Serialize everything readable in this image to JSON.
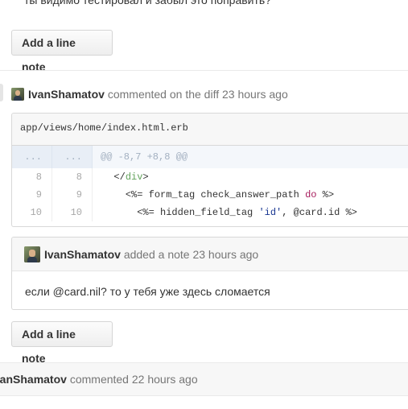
{
  "prev_comment": {
    "text": "ты видимо тестировал и забыл это поправить?"
  },
  "add_line_note_label": "Add a line note",
  "comment1": {
    "author": "IvanShamatov",
    "action": "commented on the diff",
    "time": "23 hours ago"
  },
  "file": {
    "path": "app/views/home/index.html.erb",
    "hunk": {
      "left": "...",
      "right": "...",
      "header": "@@ -8,7 +8,8 @@"
    },
    "lines": [
      {
        "left": "8",
        "right": "8",
        "indent": "  ",
        "pre": "</",
        "tag": "div",
        "post": ">",
        "kw": "",
        "str": "",
        "tail": ""
      },
      {
        "left": "9",
        "right": "9",
        "indent": "    ",
        "pre": "<%= form_tag check_answer_path ",
        "tag": "",
        "post": "",
        "kw": "do",
        "str": "",
        "tail": " %>"
      },
      {
        "left": "10",
        "right": "10",
        "indent": "      ",
        "pre": "<%= hidden_field_tag ",
        "tag": "",
        "post": "",
        "kw": "",
        "str": "'id'",
        "tail": ", @card.id %>"
      }
    ]
  },
  "note": {
    "author": "IvanShamatov",
    "action": "added a note",
    "time": "23 hours ago",
    "body": "если @card.nil? то у тебя уже здесь сломается"
  },
  "comment2": {
    "author": "IvanShamatov",
    "action": "commented",
    "time": "22 hours ago"
  },
  "colors": {
    "tag": "#63a35c",
    "keyword": "#a71d5d",
    "string": "#183691",
    "hunk_bg": "#f4f7fb"
  }
}
